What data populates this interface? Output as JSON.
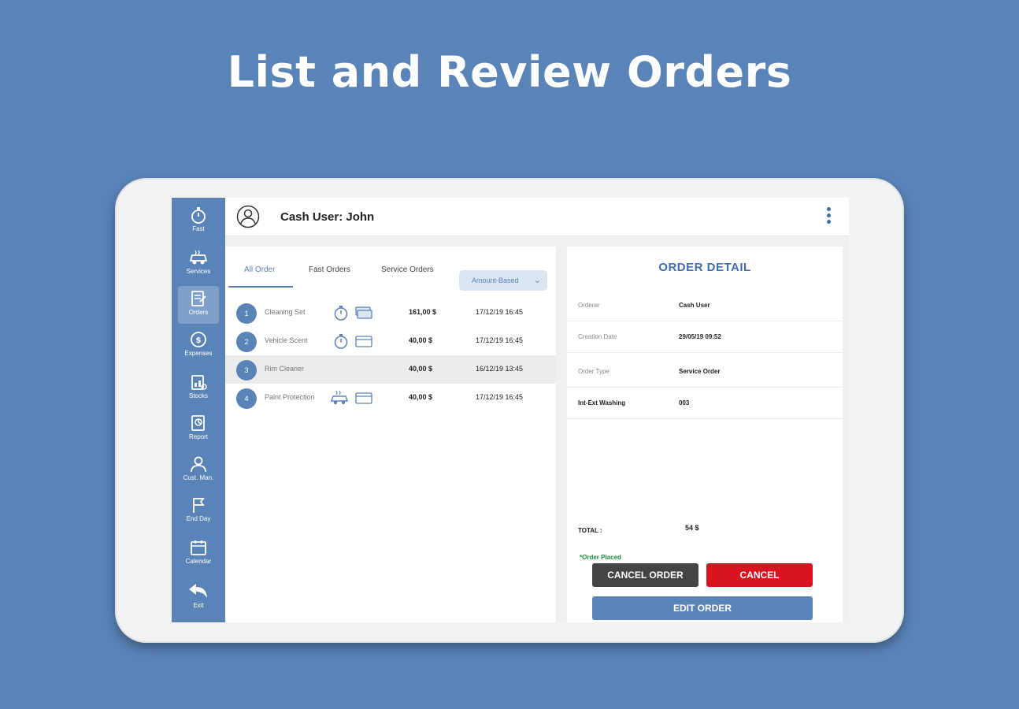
{
  "headline": "List and Review Orders",
  "colors": {
    "brand": "#5a84b8",
    "cancel_red": "#d8141e",
    "dark_button": "#444444",
    "status_green": "#1d8a3a"
  },
  "sidebar": {
    "items": [
      {
        "label": "Fast",
        "icon": "stopwatch-icon"
      },
      {
        "label": "Services",
        "icon": "car-icon"
      },
      {
        "label": "Orders",
        "icon": "orders-icon",
        "active": true
      },
      {
        "label": "Expenses",
        "icon": "coin-icon"
      },
      {
        "label": "Stocks",
        "icon": "stocks-icon"
      },
      {
        "label": "Report",
        "icon": "report-icon"
      },
      {
        "label": "Cust. Man.",
        "icon": "person-icon"
      },
      {
        "label": "End Day",
        "icon": "flag-icon"
      },
      {
        "label": "Calendar",
        "icon": "calendar-icon"
      },
      {
        "label": "Exit",
        "icon": "exit-arrow-icon"
      }
    ]
  },
  "header": {
    "title": "Cash User: John"
  },
  "tabs": [
    {
      "label": "All Order",
      "active": true
    },
    {
      "label": "Fast Orders"
    },
    {
      "label": "Service Orders"
    }
  ],
  "filter": {
    "label": "Amount-Based"
  },
  "orders": [
    {
      "num": "1",
      "name": "Cleaning Set",
      "price": "161,00 $",
      "date": "17/12/19  16:45"
    },
    {
      "num": "2",
      "name": "Vehicle Scent",
      "price": "40,00 $",
      "date": "17/12/19  16:45"
    },
    {
      "num": "3",
      "name": "Rim Cleaner",
      "price": "40,00 $",
      "date": "16/12/19  13:45"
    },
    {
      "num": "4",
      "name": "Paint Protection",
      "price": "40,00 $",
      "date": "17/12/19  16:45"
    }
  ],
  "detail": {
    "title": "ORDER DETAIL",
    "rows": [
      {
        "label": "Orderer",
        "value": "Cash User"
      },
      {
        "label": "Creation Date",
        "value": "29/05/19  09:52"
      },
      {
        "label": "Order Type",
        "value": "Service Order"
      },
      {
        "label": "Int-Ext Washing",
        "value": "003"
      }
    ],
    "total_label": "TOTAL :",
    "total_value": "54 $",
    "status": "*Order Placed",
    "cancel_order_label": "CANCEL ORDER",
    "cancel_label": "CANCEL",
    "edit_label": "EDIT ORDER"
  }
}
